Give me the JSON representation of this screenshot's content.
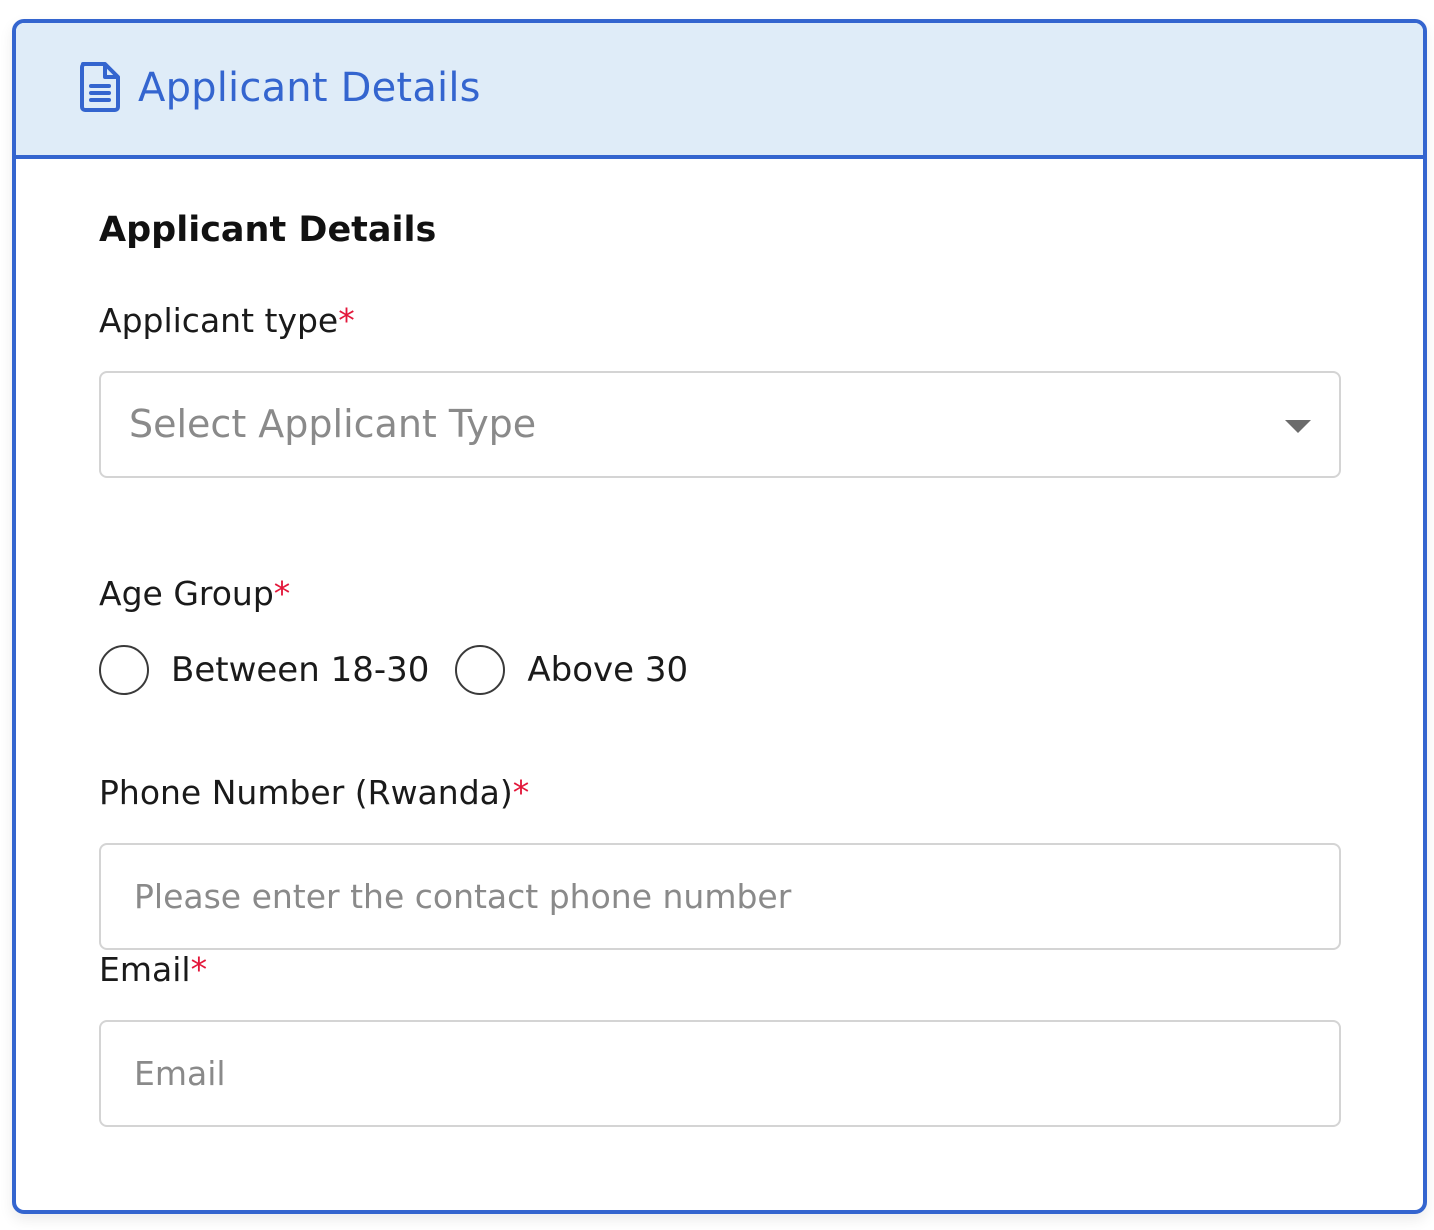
{
  "header": {
    "icon": "document-icon",
    "title": "Applicant Details",
    "accent_color": "#3465cf",
    "background_color": "#dfecf8"
  },
  "form": {
    "section_title": "Applicant Details",
    "required_marker": "*",
    "applicant_type": {
      "label": "Applicant type",
      "placeholder": "Select Applicant Type"
    },
    "age_group": {
      "label": "Age Group",
      "options": [
        "Between 18-30",
        "Above 30"
      ]
    },
    "phone": {
      "label": "Phone Number (Rwanda)",
      "placeholder": "Please enter the contact phone number"
    },
    "email": {
      "label": "Email",
      "placeholder": "Email"
    }
  }
}
